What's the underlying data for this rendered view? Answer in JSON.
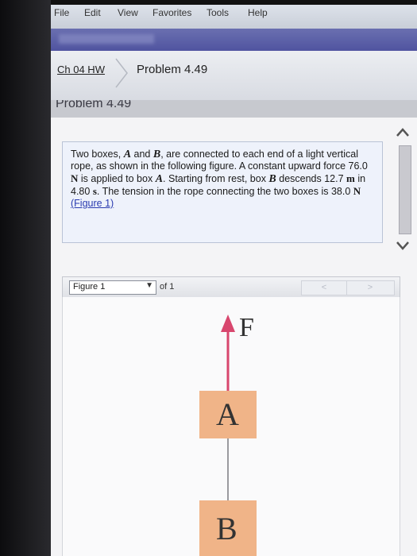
{
  "menu": [
    "File",
    "Edit",
    "View",
    "Favorites",
    "Tools",
    "Help"
  ],
  "breadcrumb": {
    "link": "Ch 04 HW",
    "current": "Problem 4.49"
  },
  "problem_heading": "Problem 4.49",
  "problem": {
    "t1": "Two boxes, ",
    "a": "A",
    "t2": " and ",
    "b": "B",
    "t3": ", are connected to each end of a light vertical rope, as shown in the following figure. A constant upward force 76.0 ",
    "unit_n1": "N",
    "t4": " is applied to box ",
    "a2": "A",
    "t5": ". Starting from rest, box ",
    "b2": "B",
    "t6": " descends 12.7 ",
    "unit_m": "m",
    "t7": " in 4.80 ",
    "unit_s": "s",
    "t8": ". The tension in the rope connecting the two boxes is 38.0 ",
    "unit_n2": "N",
    "t9": " ",
    "figure_link": "(Figure 1)"
  },
  "figure_nav": {
    "selected": "Figure 1",
    "of_text": "of 1",
    "prev": "<",
    "next": ">"
  },
  "figure": {
    "force_label": "F",
    "box_a": "A",
    "box_b": "B"
  },
  "colors": {
    "accent_blue": "#5054a0",
    "box_fill": "#f0b488",
    "arrow": "#d8476e",
    "link": "#2a3bb0"
  }
}
